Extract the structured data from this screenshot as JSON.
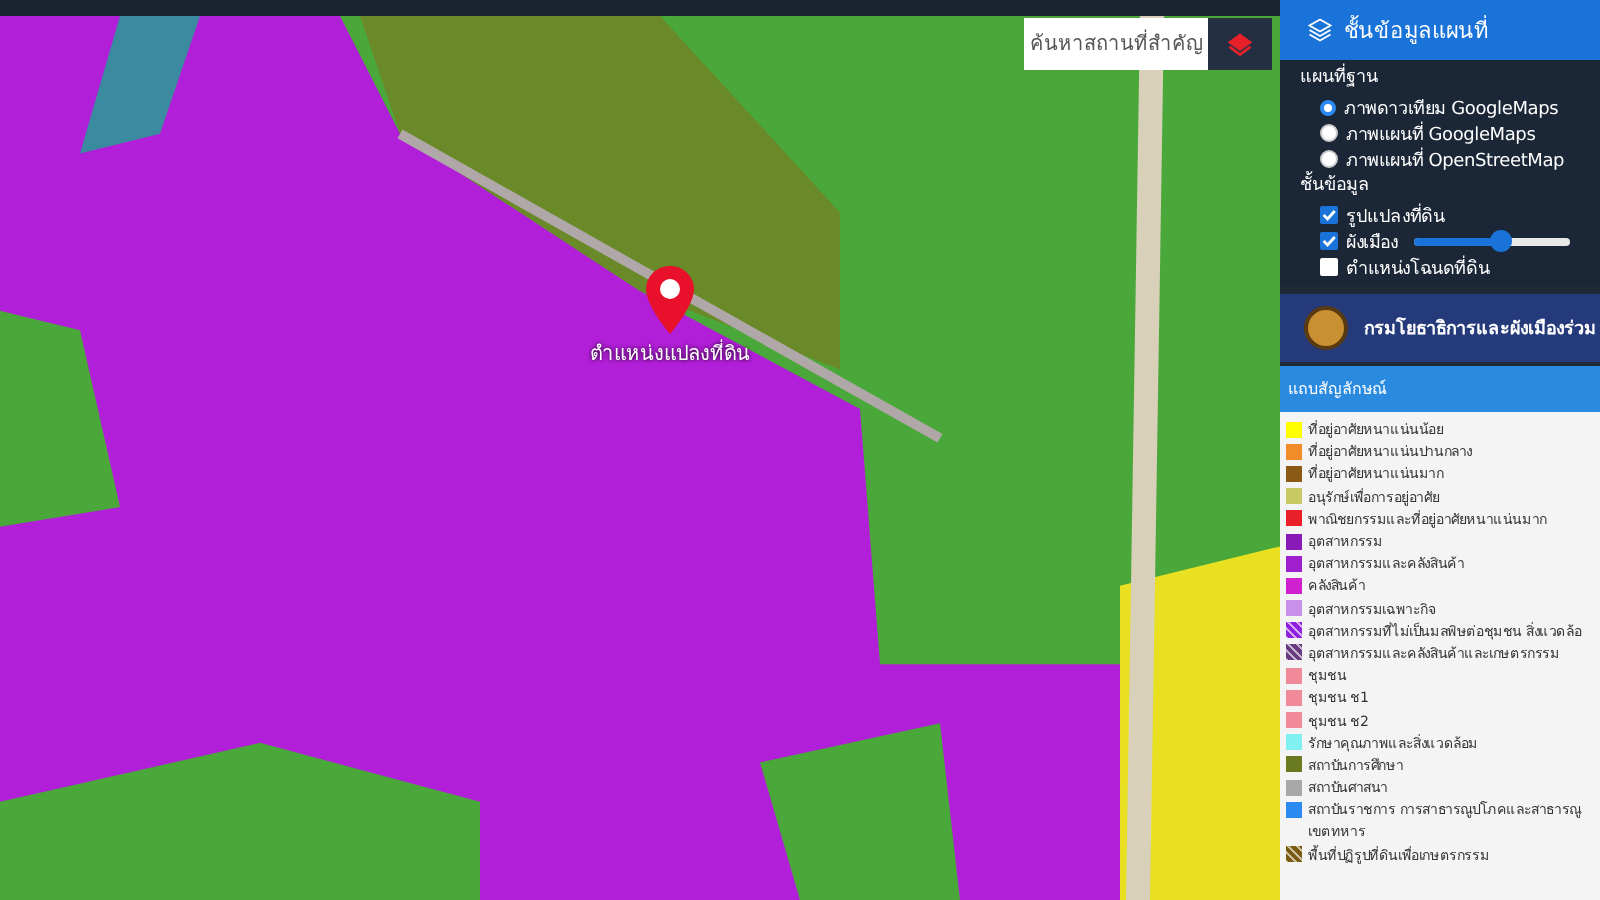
{
  "map": {
    "search": {
      "placeholder": "ค้นหาสถานที่สำคัญ"
    },
    "marker": {
      "label": "ตำแหน่งแปลงที่ดิน"
    }
  },
  "layer_panel": {
    "title": "ชั้นข้อมูลแผนที่",
    "base_map_heading": "แผนที่ฐาน",
    "base_maps": [
      {
        "label": "ภาพดาวเทียม GoogleMaps",
        "selected": true
      },
      {
        "label": "ภาพแผนที่ GoogleMaps",
        "selected": false
      },
      {
        "label": "ภาพแผนที่ OpenStreetMap",
        "selected": false
      }
    ],
    "layers_heading": "ชั้นข้อมูล",
    "layers": [
      {
        "kind": "check",
        "label": "รูปแปลงที่ดิน",
        "checked": true
      },
      {
        "kind": "slider",
        "label": "ผังเมือง",
        "checked": true,
        "level": 0.55
      },
      {
        "kind": "check",
        "label": "ตำแหน่งโฉนดที่ดิน",
        "checked": false
      }
    ]
  },
  "department": {
    "title": "กรมโยธาธิการและผังเมืองร่วม"
  },
  "legend": {
    "title": "แถบสัญลักษณ์",
    "items": [
      {
        "label": "ที่อยู่อาศัยหนาแน่นน้อย",
        "color": "#ffff00",
        "kind": "solid"
      },
      {
        "label": "ที่อยู่อาศัยหนาแน่นปานกลาง",
        "color": "#f28c28",
        "kind": "solid"
      },
      {
        "label": "ที่อยู่อาศัยหนาแน่นมาก",
        "color": "#8b5a14",
        "kind": "solid"
      },
      {
        "label": "อนุรักษ์เพื่อการอยู่อาศัย",
        "color": "#c8c864",
        "kind": "solid"
      },
      {
        "label": "พาณิชยกรรมและที่อยู่อาศัยหนาแน่นมาก",
        "color": "#e8202a",
        "kind": "solid"
      },
      {
        "label": "อุตสาหกรรม",
        "color": "#8a1ab8",
        "kind": "solid"
      },
      {
        "label": "อุตสาหกรรมและคลังสินค้า",
        "color": "#a020d0",
        "kind": "solid"
      },
      {
        "label": "คลังสินค้า",
        "color": "#d020d0",
        "kind": "solid"
      },
      {
        "label": "อุตสาหกรรมเฉพาะกิจ",
        "color": "#c890e8",
        "kind": "solid"
      },
      {
        "label": "อุตสาหกรรมที่ไม่เป็นมลพิษต่อชุมชน สิ่งแวดล้อ",
        "color": "#9020e0",
        "kind": "hatched"
      },
      {
        "label": "อุตสาหกรรมและคลังสินค้าและเกษตรกรรม",
        "color": "#6a3a80",
        "kind": "hatched"
      },
      {
        "label": "ชุมชน",
        "color": "#f08a9a",
        "kind": "solid"
      },
      {
        "label": "ชุมชน ช1",
        "color": "#f08a9a",
        "kind": "solid"
      },
      {
        "label": "ชุมชน ช2",
        "color": "#f08a9a",
        "kind": "solid"
      },
      {
        "label": "รักษาคุณภาพและสิ่งแวดล้อม",
        "color": "#80f0f0",
        "kind": "solid"
      },
      {
        "label": "สถาบันการศึกษา",
        "color": "#6a7a20",
        "kind": "solid"
      },
      {
        "label": "สถาบันศาสนา",
        "color": "#a8a8a8",
        "kind": "solid"
      },
      {
        "label": "สถาบันราชการ การสาธารณูปโภคและสาธารณู",
        "color": "#2a8af0",
        "kind": "solid"
      },
      {
        "label": "เขตทหาร",
        "kind": "text"
      },
      {
        "label": "พื้นที่ปฏิรูปที่ดินเพื่อเกษตรกรรม",
        "color": "#7a5a10",
        "kind": "hatched"
      }
    ]
  }
}
